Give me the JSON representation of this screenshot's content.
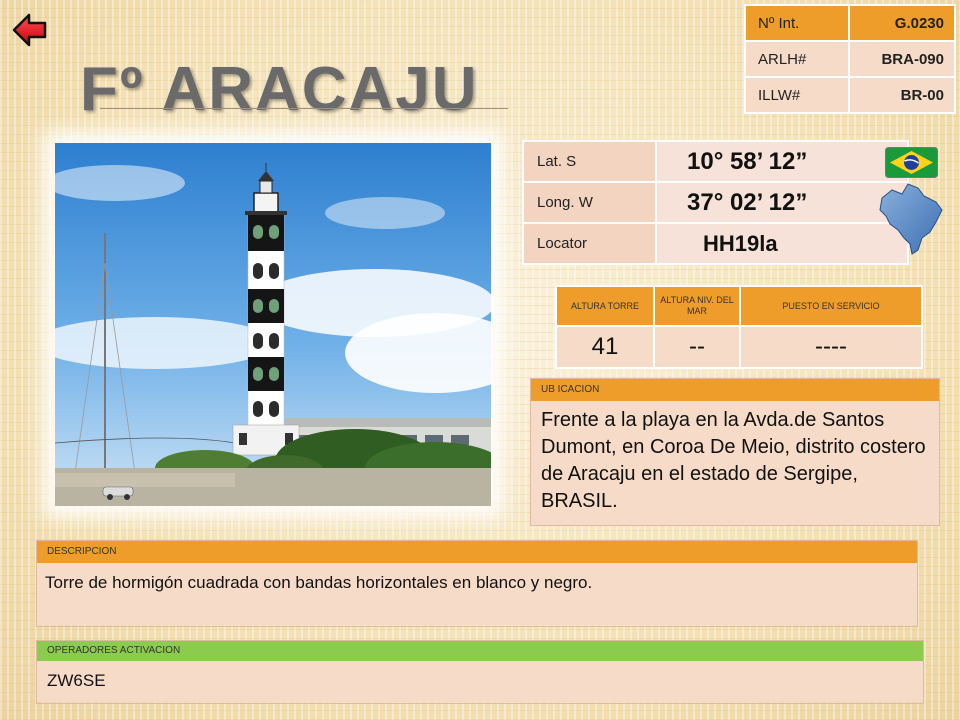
{
  "nav": {
    "back_icon": "back-arrow-icon"
  },
  "title": "Fº ARACAJU",
  "photo": {
    "subject": "lighthouse-photo"
  },
  "reference": [
    {
      "key": "Nº Int.",
      "value": "G.0230"
    },
    {
      "key": "ARLH#",
      "value": "BRA-090"
    },
    {
      "key": "ILLW#",
      "value": "BR-00"
    }
  ],
  "coordinates": [
    {
      "key": "Lat. S",
      "value": "10° 58’ 12”"
    },
    {
      "key": "Long. W",
      "value": "37° 02’ 12”"
    },
    {
      "key": "Locator",
      "value": "HH19la"
    }
  ],
  "country": {
    "flag_icon": "brazil-flag-icon",
    "map_icon": "brazil-map-icon"
  },
  "altura": {
    "headers": [
      "ALTURA TORRE",
      "ALTURA NIV. DEL MAR",
      "PUESTO EN SERVICIO"
    ],
    "values": [
      "41",
      "--",
      "----"
    ]
  },
  "ubicacion": {
    "header": "UB ICACION",
    "text": "Frente a la playa en la Avda.de Santos Dumont, en Coroa De Meio, distrito costero de Aracaju en el estado de Sergipe, BRASIL."
  },
  "descripcion": {
    "header": "DESCRIPCION",
    "text": "Torre de hormigón cuadrada con bandas horizontales en blanco y negro."
  },
  "operadores": {
    "header": "OPERADORES ACTIVACION",
    "text": "ZW6SE"
  },
  "colors": {
    "header_orange": "#ee9d2a",
    "header_green": "#8ccc4c",
    "cell_pink": "#f6dcc8",
    "title_gray": "#6a6a6a",
    "arrow_red": "#e8202a"
  }
}
